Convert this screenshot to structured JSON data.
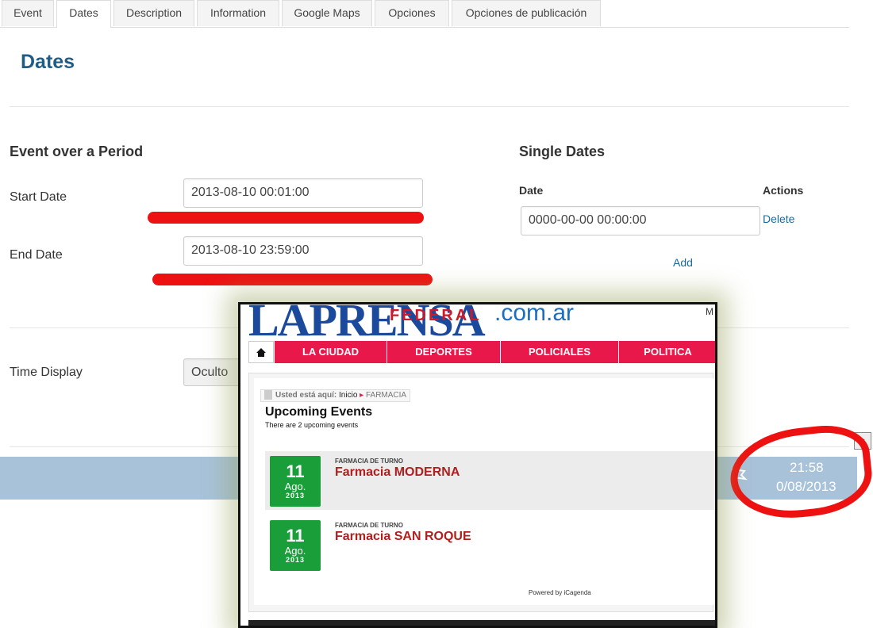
{
  "tabs": [
    "Event",
    "Dates",
    "Description",
    "Information",
    "Google Maps",
    "Opciones",
    "Opciones de publicación"
  ],
  "page_title": "Dates",
  "period": {
    "title": "Event over a Period",
    "start_label": "Start Date",
    "start_value": "2013-08-10 00:01:00",
    "end_label": "End Date",
    "end_value": "2013-08-10 23:59:00"
  },
  "single": {
    "title": "Single Dates",
    "date_header": "Date",
    "actions_header": "Actions",
    "date_value": "0000-00-00 00:00:00",
    "delete_label": "Delete",
    "add_label": "Add"
  },
  "time_display": {
    "label": "Time Display",
    "value": "Oculto"
  },
  "taskbar": {
    "time": "21:58",
    "date": "0/08/2013"
  },
  "overlay": {
    "logo_main": "LAPRENSA",
    "logo_federal": "FEDERAL",
    "logo_domain": ".com.ar",
    "corner_text": "M",
    "nav": [
      "LA CIUDAD",
      "DEPORTES",
      "POLICIALES",
      "POLITICA"
    ],
    "breadcrumb_prefix": "Usted está aquí:",
    "breadcrumb_home": "Inicio",
    "breadcrumb_current": "FARMACIA",
    "heading": "Upcoming Events",
    "subheading": "There are 2 upcoming events",
    "events": [
      {
        "day": "11",
        "month": "Ago.",
        "year": "2013",
        "category": "FARMACIA DE TURNO",
        "title": "Farmacia MODERNA"
      },
      {
        "day": "11",
        "month": "Ago.",
        "year": "2013",
        "category": "FARMACIA DE TURNO",
        "title": "Farmacia SAN ROQUE"
      }
    ],
    "powered_by": "Powered by iCagenda"
  },
  "colors": {
    "title_blue": "#1f5c86",
    "link_blue": "#1a6b9b",
    "annotation_red": "#ee1111",
    "nav_pink": "#e8194a",
    "date_green": "#199e3a",
    "event_red": "#b21d1d"
  }
}
